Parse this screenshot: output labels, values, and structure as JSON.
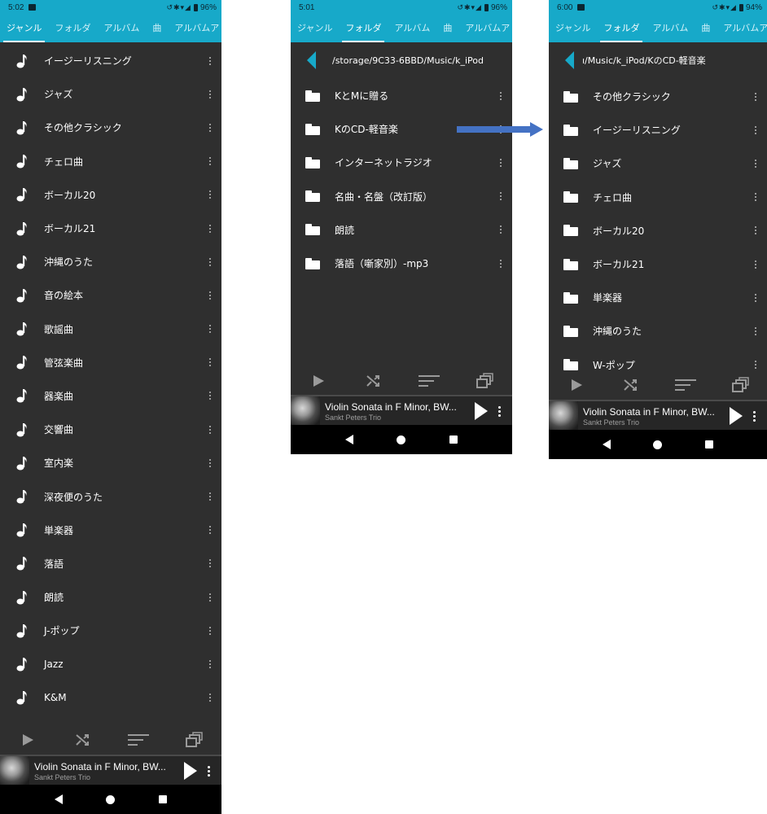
{
  "colors": {
    "accent": "#17a9c9",
    "panel": "#2f2f2f",
    "arrow": "#4472c4"
  },
  "shared": {
    "tabs": [
      "ジャンル",
      "フォルダ",
      "アルバム",
      "曲",
      "アルバムア"
    ],
    "now_playing": {
      "title": "Violin Sonata in F Minor, BW...",
      "artist": "Sankt Peters Trio"
    }
  },
  "phone1": {
    "status": {
      "time": "5:02",
      "battery": "96%"
    },
    "active_tab": 0,
    "genres": [
      "イージーリスニング",
      "ジャズ",
      "その他クラシック",
      "チェロ曲",
      "ボーカル20",
      "ボーカル21",
      "沖縄のうた",
      "音の絵本",
      "歌謡曲",
      "管弦楽曲",
      "器楽曲",
      "交響曲",
      "室内楽",
      "深夜便のうた",
      "単楽器",
      "落語",
      "朗読",
      "J-ポップ",
      "Jazz",
      "K&M"
    ]
  },
  "phone2": {
    "status": {
      "time": "5:01",
      "battery": "96%"
    },
    "active_tab": 1,
    "path": "/storage/9C33-6BBD/Music/k_iPod",
    "folders": [
      "KとMに贈る",
      "KのCD-軽音楽",
      "インターネットラジオ",
      "名曲・名盤（改訂版）",
      "朗読",
      "落語（噺家別）-mp3"
    ]
  },
  "phone3": {
    "status": {
      "time": "6:00",
      "battery": "94%"
    },
    "active_tab": 1,
    "path": "ı/Music/k_iPod/KのCD-軽音楽",
    "folders": [
      "その他クラシック",
      "イージーリスニング",
      "ジャズ",
      "チェロ曲",
      "ボーカル20",
      "ボーカル21",
      "単楽器",
      "沖縄のうた",
      "W-ポップ"
    ]
  }
}
